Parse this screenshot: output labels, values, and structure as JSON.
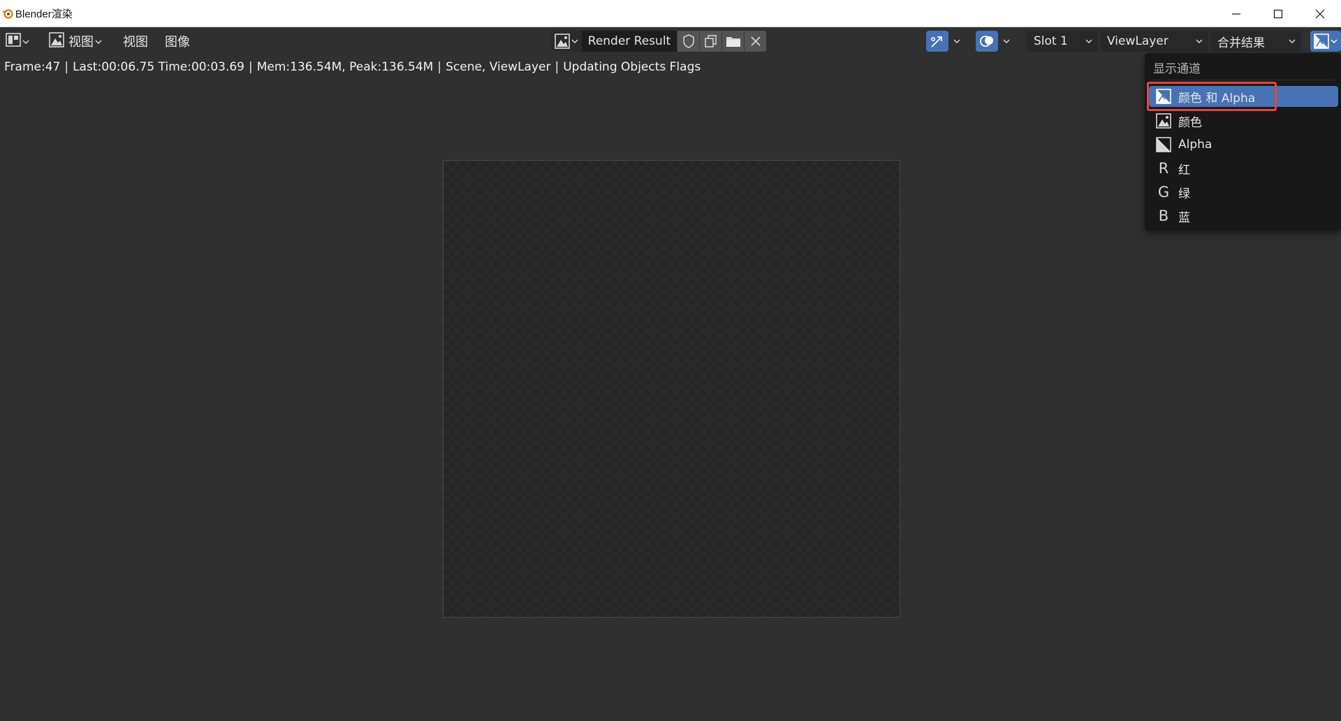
{
  "window": {
    "title": "Blender渲染",
    "logo_icon": "blender-logo-icon",
    "controls": [
      "minimize-icon",
      "maximize-icon",
      "close-icon"
    ]
  },
  "header": {
    "editor_type_icon": "image-editor-icon",
    "view_mode_label": "视图",
    "menus": [
      "视图",
      "图像"
    ],
    "image_name": "Render Result",
    "image_icons": [
      "fake-user-shield-icon",
      "duplicate-image-icon",
      "open-folder-icon",
      "unlink-x-icon"
    ],
    "slot": "Slot 1",
    "view_layer": "ViewLayer",
    "pass": "合并结果"
  },
  "status": {
    "frame": "Frame:47",
    "times": "Last:00:06.75 Time:00:03.69",
    "memory": "Mem:136.54M, Peak:136.54M",
    "scene": "Scene, ViewLayer",
    "message": "Updating Objects Flags"
  },
  "channels_menu": {
    "title": "显示通道",
    "items": [
      {
        "label": "颜色 和 Alpha",
        "icon": "color-alpha-icon",
        "active": true
      },
      {
        "label": "颜色",
        "icon": "image-icon",
        "active": false
      },
      {
        "label": "Alpha",
        "icon": "alpha-icon",
        "active": false
      },
      {
        "label": "红",
        "icon": "R",
        "active": false
      },
      {
        "label": "绿",
        "icon": "G",
        "active": false
      },
      {
        "label": "蓝",
        "icon": "B",
        "active": false
      }
    ]
  },
  "colors": {
    "accent": "#4772b3",
    "highlight_border": "#e8433f",
    "background": "#303030"
  }
}
